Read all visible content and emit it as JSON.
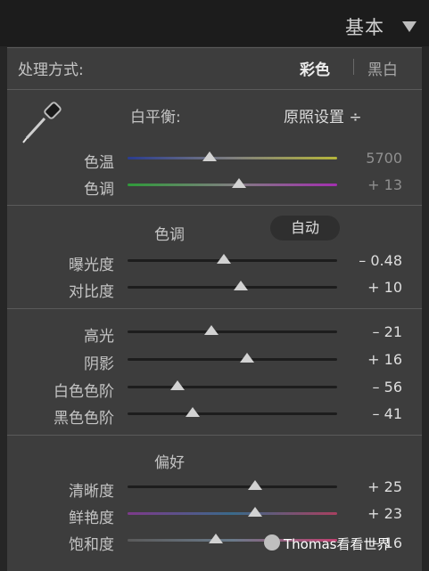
{
  "panel": {
    "title": "基本"
  },
  "treatment": {
    "label": "处理方式:",
    "color": "彩色",
    "bw": "黑白"
  },
  "white_balance": {
    "label": "白平衡:",
    "value": "原照设置 ÷"
  },
  "tone_header": {
    "label": "色调",
    "auto": "自动"
  },
  "presence_header": {
    "label": "偏好"
  },
  "sliders": {
    "temp": {
      "label": "色温",
      "value": "5700",
      "level": 0.39
    },
    "tint": {
      "label": "色调",
      "value": "+ 13",
      "level": 0.53
    },
    "exposure": {
      "label": "曝光度",
      "value": "– 0.48",
      "level": 0.46
    },
    "contrast": {
      "label": "对比度",
      "value": "+ 10",
      "level": 0.54
    },
    "highlights": {
      "label": "高光",
      "value": "– 21",
      "level": 0.4
    },
    "shadows": {
      "label": "阴影",
      "value": "+ 16",
      "level": 0.57
    },
    "whites": {
      "label": "白色色阶",
      "value": "– 56",
      "level": 0.24
    },
    "blacks": {
      "label": "黑色色阶",
      "value": "– 41",
      "level": 0.31
    },
    "clarity": {
      "label": "清晰度",
      "value": "+ 25",
      "level": 0.61
    },
    "vibrance": {
      "label": "鲜艳度",
      "value": "+ 23",
      "level": 0.61
    },
    "saturation": {
      "label": "饱和度",
      "value": "– 16",
      "level": 0.42
    }
  },
  "watermark": {
    "text": "Thomas看看世界"
  },
  "colors": {
    "temp_gradient": [
      "#2a3c8f",
      "#7f7f7f",
      "#b5b53a"
    ],
    "tint_gradient": [
      "#2f9a3a",
      "#7f7f7f",
      "#a32fb0"
    ],
    "vibrance_gradient": [
      "#7d3a8a",
      "#3a6a8a",
      "#a84060"
    ],
    "saturation_gradient": [
      "#5a5a5a",
      "#6a7a8a",
      "#c04070"
    ]
  }
}
